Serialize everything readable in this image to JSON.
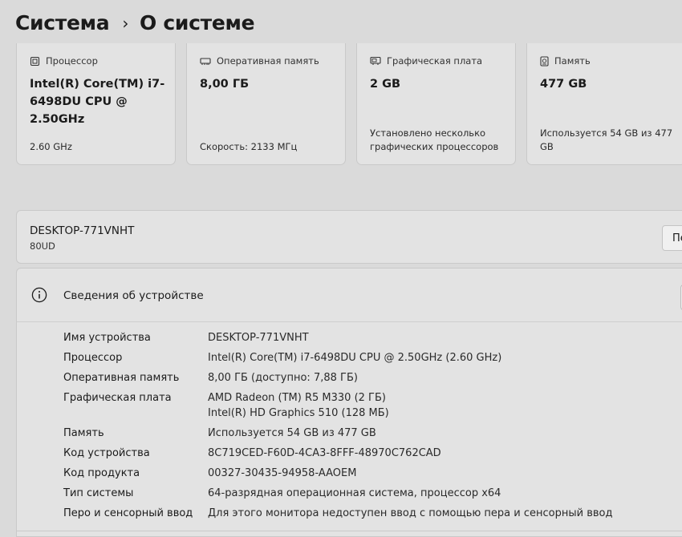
{
  "breadcrumb": {
    "parent": "Система",
    "separator": "›",
    "current": "О системе"
  },
  "cards": [
    {
      "label": "Процессор",
      "icon": "processor-icon",
      "value": "Intel(R) Core(TM) i7-6498DU CPU @ 2.50GHz",
      "sub": "2.60 GHz"
    },
    {
      "label": "Оперативная память",
      "icon": "memory-icon",
      "value": "8,00 ГБ",
      "sub": "Скорость: 2133 МГц"
    },
    {
      "label": "Графическая плата",
      "icon": "graphics-card-icon",
      "value": "2 GB",
      "sub": "Установлено несколько графических процессоров"
    },
    {
      "label": "Память",
      "icon": "storage-icon",
      "value": "477 GB",
      "sub": "Используется 54 GB из 477 GB"
    }
  ],
  "device": {
    "name": "DESKTOP-771VNHT",
    "model": "80UD",
    "rename_button": "Пе"
  },
  "device_info": {
    "title": "Сведения об устройстве",
    "rows": [
      {
        "label": "Имя устройства",
        "value": "DESKTOP-771VNHT"
      },
      {
        "label": "Процессор",
        "value": "Intel(R) Core(TM) i7-6498DU CPU @ 2.50GHz (2.60 GHz)"
      },
      {
        "label": "Оперативная память",
        "value": "8,00 ГБ (доступно: 7,88 ГБ)"
      },
      {
        "label": "Графическая плата",
        "value": "AMD Radeon (TM) R5 M330 (2 ГБ)",
        "value2": "Intel(R) HD Graphics 510 (128 МБ)"
      },
      {
        "label": "Память",
        "value": "Используется 54 GB из 477 GB"
      },
      {
        "label": "Код устройства",
        "value": "8C719CED-F60D-4CA3-8FFF-48970C762CAD"
      },
      {
        "label": "Код продукта",
        "value": "00327-30435-94958-AAOEM"
      },
      {
        "label": "Тип системы",
        "value": "64-разрядная операционная система, процессор x64"
      },
      {
        "label": "Перо и сенсорный ввод",
        "value": "Для этого монитора недоступен ввод с помощью пера и сенсорный ввод"
      }
    ]
  }
}
